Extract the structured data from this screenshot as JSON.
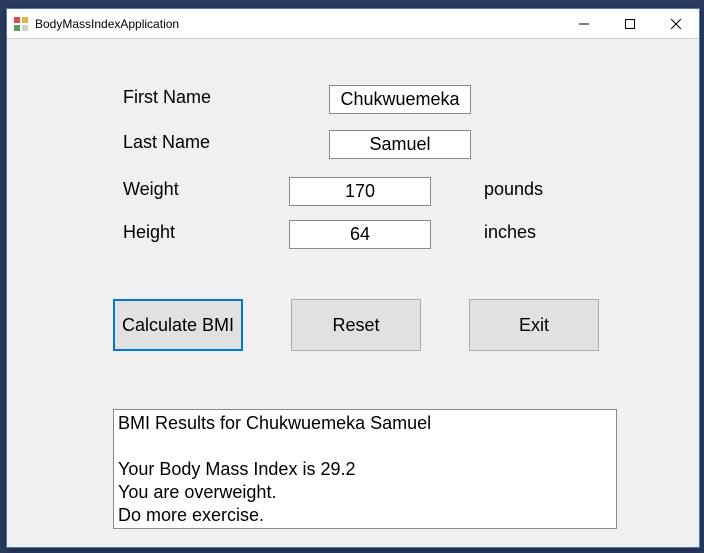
{
  "window": {
    "title": "BodyMassIndexApplication"
  },
  "labels": {
    "first_name": "First Name",
    "last_name": "Last Name",
    "weight": "Weight",
    "height": "Height",
    "pounds": "pounds",
    "inches": "inches"
  },
  "inputs": {
    "first_name": "Chukwuemeka",
    "last_name": "Samuel",
    "weight": "170",
    "height": "64"
  },
  "buttons": {
    "calculate": "Calculate BMI",
    "reset": "Reset",
    "exit": "Exit"
  },
  "results": "BMI Results for Chukwuemeka Samuel\n\nYour Body Mass Index is 29.2\nYou are overweight.\nDo more exercise."
}
